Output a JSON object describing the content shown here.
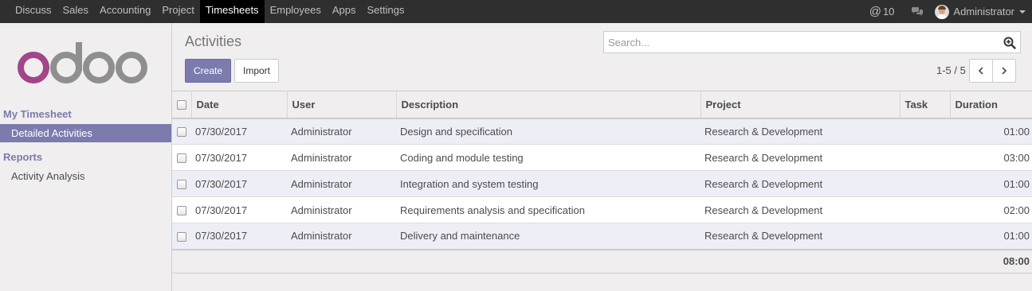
{
  "topbar": {
    "menu": [
      {
        "label": "Discuss",
        "active": false
      },
      {
        "label": "Sales",
        "active": false
      },
      {
        "label": "Accounting",
        "active": false
      },
      {
        "label": "Project",
        "active": false
      },
      {
        "label": "Timesheets",
        "active": true
      },
      {
        "label": "Employees",
        "active": false
      },
      {
        "label": "Apps",
        "active": false
      },
      {
        "label": "Settings",
        "active": false
      }
    ],
    "mentions_count": "10",
    "user_name": "Administrator"
  },
  "sidebar": {
    "logo_text": "odoo",
    "sections": [
      {
        "title": "My Timesheet",
        "items": [
          {
            "label": "Detailed Activities",
            "active": true
          }
        ]
      },
      {
        "title": "Reports",
        "items": [
          {
            "label": "Activity Analysis",
            "active": false
          }
        ]
      }
    ]
  },
  "control_panel": {
    "title": "Activities",
    "create_label": "Create",
    "import_label": "Import",
    "search_placeholder": "Search...",
    "pager": "1-5 / 5"
  },
  "table": {
    "columns": [
      "Date",
      "User",
      "Description",
      "Project",
      "Task",
      "Duration"
    ],
    "rows": [
      {
        "date": "07/30/2017",
        "user": "Administrator",
        "description": "Design and specification",
        "project": "Research & Development",
        "task": "",
        "duration": "01:00"
      },
      {
        "date": "07/30/2017",
        "user": "Administrator",
        "description": "Coding and module testing",
        "project": "Research & Development",
        "task": "",
        "duration": "03:00"
      },
      {
        "date": "07/30/2017",
        "user": "Administrator",
        "description": "Integration and system testing",
        "project": "Research & Development",
        "task": "",
        "duration": "01:00"
      },
      {
        "date": "07/30/2017",
        "user": "Administrator",
        "description": "Requirements analysis and specification",
        "project": "Research & Development",
        "task": "",
        "duration": "02:00"
      },
      {
        "date": "07/30/2017",
        "user": "Administrator",
        "description": "Delivery and maintenance",
        "project": "Research & Development",
        "task": "",
        "duration": "01:00"
      }
    ],
    "total_duration": "08:00"
  },
  "colors": {
    "brand": "#7c7bad",
    "navbar": "#2f2f2f",
    "logo_o": "#a24689",
    "logo_gray": "#8f8f8f"
  },
  "icons": {
    "mentions": "at-icon",
    "chat": "comments-icon",
    "search": "search-plus-icon",
    "prev": "chevron-left-icon",
    "next": "chevron-right-icon"
  }
}
